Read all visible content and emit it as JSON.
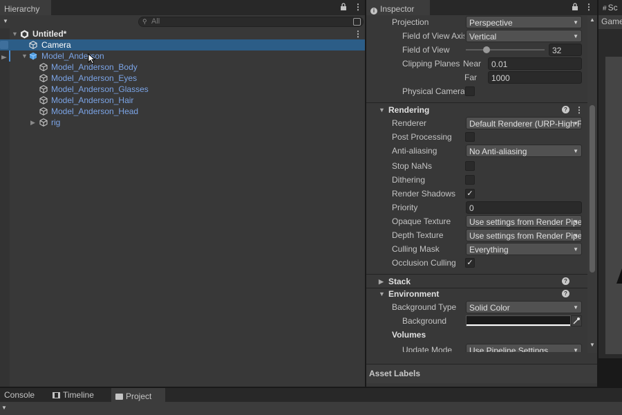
{
  "hierarchy": {
    "tab_label": "Hierarchy",
    "search_placeholder": "All",
    "scene_name": "Untitled*",
    "items": [
      {
        "label": "Camera"
      },
      {
        "label": "Model_Anderson"
      },
      {
        "label": "Model_Anderson_Body"
      },
      {
        "label": "Model_Anderson_Eyes"
      },
      {
        "label": "Model_Anderson_Glasses"
      },
      {
        "label": "Model_Anderson_Hair"
      },
      {
        "label": "Model_Anderson_Head"
      },
      {
        "label": "rig"
      }
    ]
  },
  "inspector": {
    "tab_label": "Inspector",
    "projection": {
      "label": "Projection",
      "value": "Perspective"
    },
    "fov_axis": {
      "label": "Field of View Axis",
      "value": "Vertical"
    },
    "fov": {
      "label": "Field of View",
      "value": "32",
      "slider_fraction": 0.24
    },
    "clipping": {
      "label": "Clipping Planes",
      "near_label": "Near",
      "near": "0.01",
      "far_label": "Far",
      "far": "1000"
    },
    "physical_camera": {
      "label": "Physical Camera"
    },
    "rendering": {
      "title": "Rendering",
      "renderer": {
        "label": "Renderer",
        "value": "Default Renderer (URP-High Fidelity)"
      },
      "post_processing": {
        "label": "Post Processing",
        "checked": false
      },
      "anti_aliasing": {
        "label": "Anti-aliasing",
        "value": "No Anti-aliasing"
      },
      "stop_nans": {
        "label": "Stop NaNs",
        "checked": false
      },
      "dithering": {
        "label": "Dithering",
        "checked": false
      },
      "render_shadows": {
        "label": "Render Shadows",
        "checked": true
      },
      "priority": {
        "label": "Priority",
        "value": "0"
      },
      "opaque_texture": {
        "label": "Opaque Texture",
        "value": "Use settings from Render Pipeline Asset"
      },
      "depth_texture": {
        "label": "Depth Texture",
        "value": "Use settings from Render Pipeline Asset"
      },
      "culling_mask": {
        "label": "Culling Mask",
        "value": "Everything"
      },
      "occlusion_culling": {
        "label": "Occlusion Culling",
        "checked": true
      }
    },
    "stack": {
      "title": "Stack"
    },
    "environment": {
      "title": "Environment",
      "background_type": {
        "label": "Background Type",
        "value": "Solid Color"
      },
      "background": {
        "label": "Background",
        "color": "#1a1a1a"
      },
      "volumes_label": "Volumes",
      "update_mode": {
        "label": "Update Mode",
        "value": "Use Pipeline Settings"
      }
    },
    "asset_labels": "Asset Labels"
  },
  "scene": {
    "tab_label": "Sc",
    "game_label": "Game"
  },
  "bottom_tabs": [
    {
      "label": "Console",
      "icon": ""
    },
    {
      "label": "Timeline",
      "icon": "timeline-icon"
    },
    {
      "label": "Project",
      "icon": "folder-icon"
    }
  ],
  "colors": {
    "selection": "#2c5d87",
    "prefab_text": "#7ba4e6",
    "panel_bg": "#383838"
  }
}
